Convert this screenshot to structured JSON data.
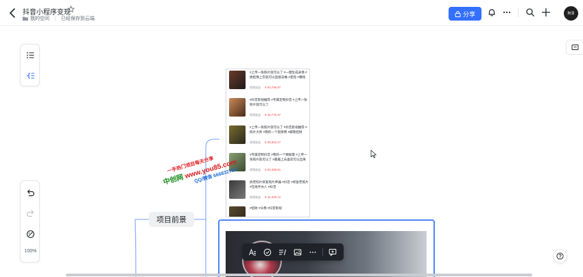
{
  "header": {
    "title": "抖音小程序变现",
    "breadcrumb_space": "我的空间",
    "save_status": "已经保存到云端",
    "share_label": "分享",
    "avatar_text": "阿泽"
  },
  "left_toolbar": {
    "zoom": "100%"
  },
  "mindmap": {
    "main_node": "项目前景"
  },
  "screenshot_list": [
    {
      "text": "#上传一张照片就可以了 #一键生成表情 #换脸像上衣就可以直接去做 #变现 #赚钱",
      "tag": "视频收益",
      "price": "¥ 60,796.97"
    },
    {
      "text": "#抖音影视推荐 #专属定制抖音 #上传一张照片就可以了",
      "tag": "视频收益",
      "price": "¥ 48,775.37"
    },
    {
      "text": "#上传一张照片就可以了 #抖音影视推荐 #照片大师 #我的一个就够用 #解锁招财",
      "tag": "视频收益",
      "price": "¥ 39,603.27"
    },
    {
      "text": "#专属定制抖音 #我的一个数据量 #上传一张照片就可以了 #最最上去喜欢可以出来",
      "tag": "视频收益",
      "price": "¥ 26,498.91"
    },
    {
      "text": "搞老照片修复照片神器 #抖音 #修复老照片 #在线手办人 #抖音",
      "tag": "视频收益",
      "price": "¥ 34,329.12"
    },
    {
      "text": "#招财 #头像 #抖音影视",
      "tag": "",
      "price": ""
    }
  ],
  "watermark": {
    "line1": "一手热门项目每天分享",
    "line2_prefix": "中创网",
    "line2_url": "www.you85.com",
    "line3": "QQ/微信 666832713"
  },
  "colors": {
    "accent": "#3370ff",
    "selection_border": "#4e83fd",
    "price_red": "#f54a45"
  },
  "icons": {
    "back": "chevron-left-icon",
    "star": "star-icon",
    "bell": "bell-icon",
    "more": "more-icon",
    "search": "search-icon",
    "add": "plus-icon"
  }
}
